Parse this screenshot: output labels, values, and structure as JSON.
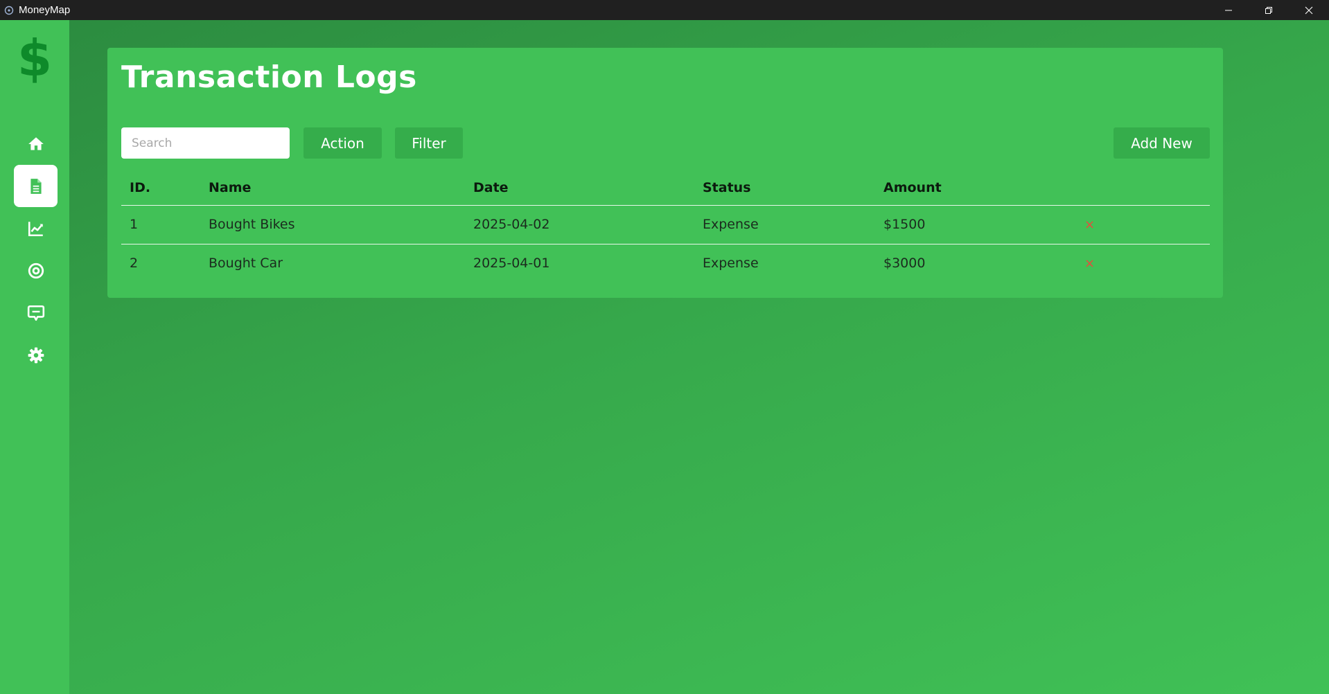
{
  "window": {
    "title": "MoneyMap"
  },
  "sidebar": {
    "logo_icon": "dollar-sign-icon",
    "items": [
      {
        "name": "home",
        "icon": "home-icon",
        "active": false
      },
      {
        "name": "transactions",
        "icon": "document-icon",
        "active": true
      },
      {
        "name": "analytics",
        "icon": "chart-line-icon",
        "active": false
      },
      {
        "name": "goals",
        "icon": "target-icon",
        "active": false
      },
      {
        "name": "chat",
        "icon": "chat-icon",
        "active": false
      },
      {
        "name": "settings",
        "icon": "gear-icon",
        "active": false
      }
    ]
  },
  "main": {
    "title": "Transaction Logs",
    "search": {
      "placeholder": "Search",
      "value": ""
    },
    "buttons": {
      "action": "Action",
      "filter": "Filter",
      "add_new": "Add New"
    },
    "table": {
      "headers": [
        "ID.",
        "Name",
        "Date",
        "Status",
        "Amount"
      ],
      "rows": [
        {
          "id": "1",
          "name": "Bought Bikes",
          "date": "2025-04-02",
          "status": "Expense",
          "amount": "$1500",
          "delete": "×"
        },
        {
          "id": "2",
          "name": "Bought Car",
          "date": "2025-04-01",
          "status": "Expense",
          "amount": "$3000",
          "delete": "×"
        }
      ]
    }
  },
  "colors": {
    "sidebar_bg": "#41c157",
    "card_bg": "#41c157",
    "button_bg": "#35ad4b",
    "logo": "#0e8a2a",
    "delete": "#e74c3c"
  }
}
